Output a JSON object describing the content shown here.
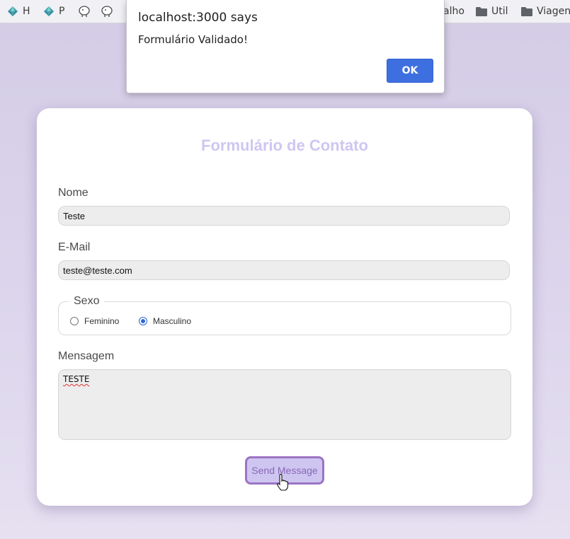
{
  "bookmarks": {
    "items": [
      {
        "label": "H",
        "icon": "gem-icon"
      },
      {
        "label": "P",
        "icon": "gem-icon"
      },
      {
        "label": "",
        "icon": "postgres-elephant-icon"
      },
      {
        "label": "",
        "icon": "postgres-elephant-icon"
      },
      {
        "label": "alho",
        "icon": ""
      },
      {
        "label": "Util",
        "icon": "folder-icon"
      },
      {
        "label": "Viagen",
        "icon": "folder-icon"
      }
    ]
  },
  "alert": {
    "title": "localhost:3000 says",
    "message": "Formulário Validado!",
    "ok_label": "OK"
  },
  "form": {
    "title": "Formulário de Contato",
    "name_label": "Nome",
    "name_value": "Teste",
    "email_label": "E-Mail",
    "email_value": "teste@teste.com",
    "sex_legend": "Sexo",
    "sex_options": [
      {
        "label": "Feminino",
        "checked": false
      },
      {
        "label": "Masculino",
        "checked": true
      }
    ],
    "message_label": "Mensagem",
    "message_value": "TESTE",
    "submit_label": "Send Message"
  },
  "colors": {
    "accent": "#3d6fe0",
    "title": "#cfc6f1",
    "button_bg": "#cec6f1",
    "button_border": "#9c74c4"
  }
}
